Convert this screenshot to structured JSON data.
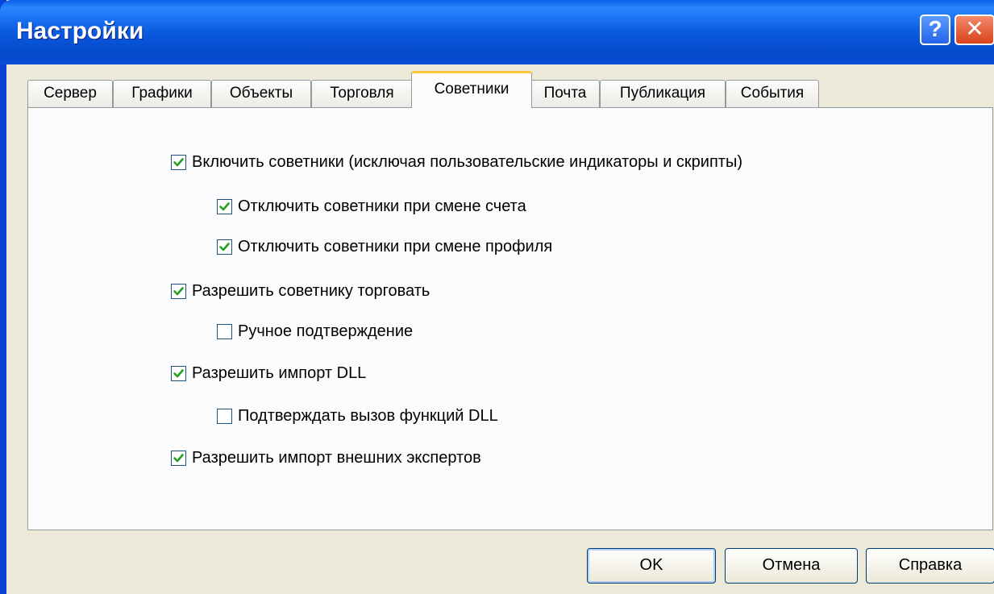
{
  "window": {
    "title": "Настройки",
    "help_glyph": "?",
    "close_glyph": "✕"
  },
  "tabs": [
    {
      "label": "Сервер",
      "active": false
    },
    {
      "label": "Графики",
      "active": false
    },
    {
      "label": "Объекты",
      "active": false
    },
    {
      "label": "Торговля",
      "active": false
    },
    {
      "label": "Советники",
      "active": true
    },
    {
      "label": "Почта",
      "active": false
    },
    {
      "label": "Публикация",
      "active": false
    },
    {
      "label": "События",
      "active": false
    }
  ],
  "options": [
    {
      "label": "Включить советники (исключая пользовательские индикаторы и скрипты)",
      "checked": true
    },
    {
      "label": "Отключить советники при смене счета",
      "checked": true
    },
    {
      "label": "Отключить советники при смене профиля",
      "checked": true
    },
    {
      "label": "Разрешить советнику торговать",
      "checked": true
    },
    {
      "label": "Ручное подтверждение",
      "checked": false
    },
    {
      "label": "Разрешить импорт DLL",
      "checked": true
    },
    {
      "label": "Подтверждать вызов функций DLL",
      "checked": false
    },
    {
      "label": "Разрешить импорт внешних экспертов",
      "checked": true
    }
  ],
  "buttons": {
    "ok": "OK",
    "cancel": "Отмена",
    "help": "Справка"
  },
  "colors": {
    "titlebar": "#0a5ae0",
    "dialog_bg": "#ece9d8",
    "check_mark": "#21a121",
    "active_tab_accent": "#ffc83c"
  }
}
